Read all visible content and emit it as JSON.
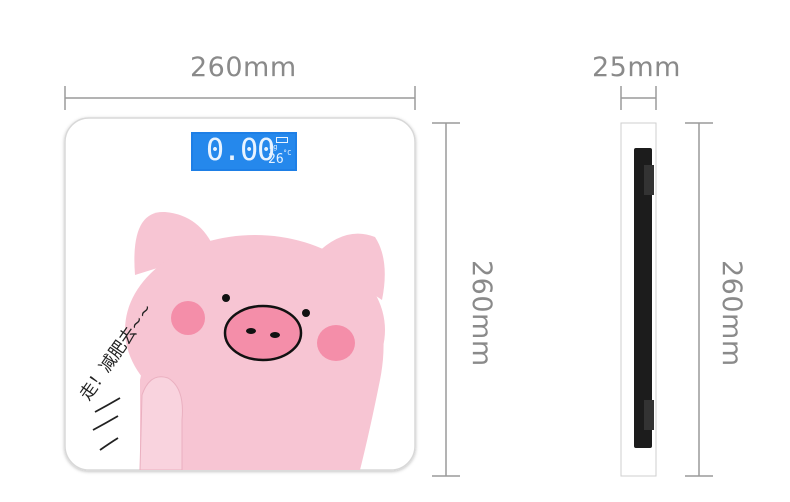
{
  "dimensions": {
    "top_width_label": "260mm",
    "side_thickness_label": "25mm",
    "front_height_label": "260mm",
    "side_height_label": "260mm"
  },
  "display": {
    "weight": "0.00",
    "unit": "kg",
    "temperature": "26",
    "temp_unit": "°C",
    "screen_color": "#1e7fe6"
  },
  "decal": {
    "chinese_text": "走！减肥去~~",
    "pig_color": "#f7c5d3",
    "cheek_color": "#f48ea9"
  },
  "colors": {
    "line": "#9a9a9a",
    "label": "#8a8a8a",
    "scale_body": "#ffffff"
  }
}
